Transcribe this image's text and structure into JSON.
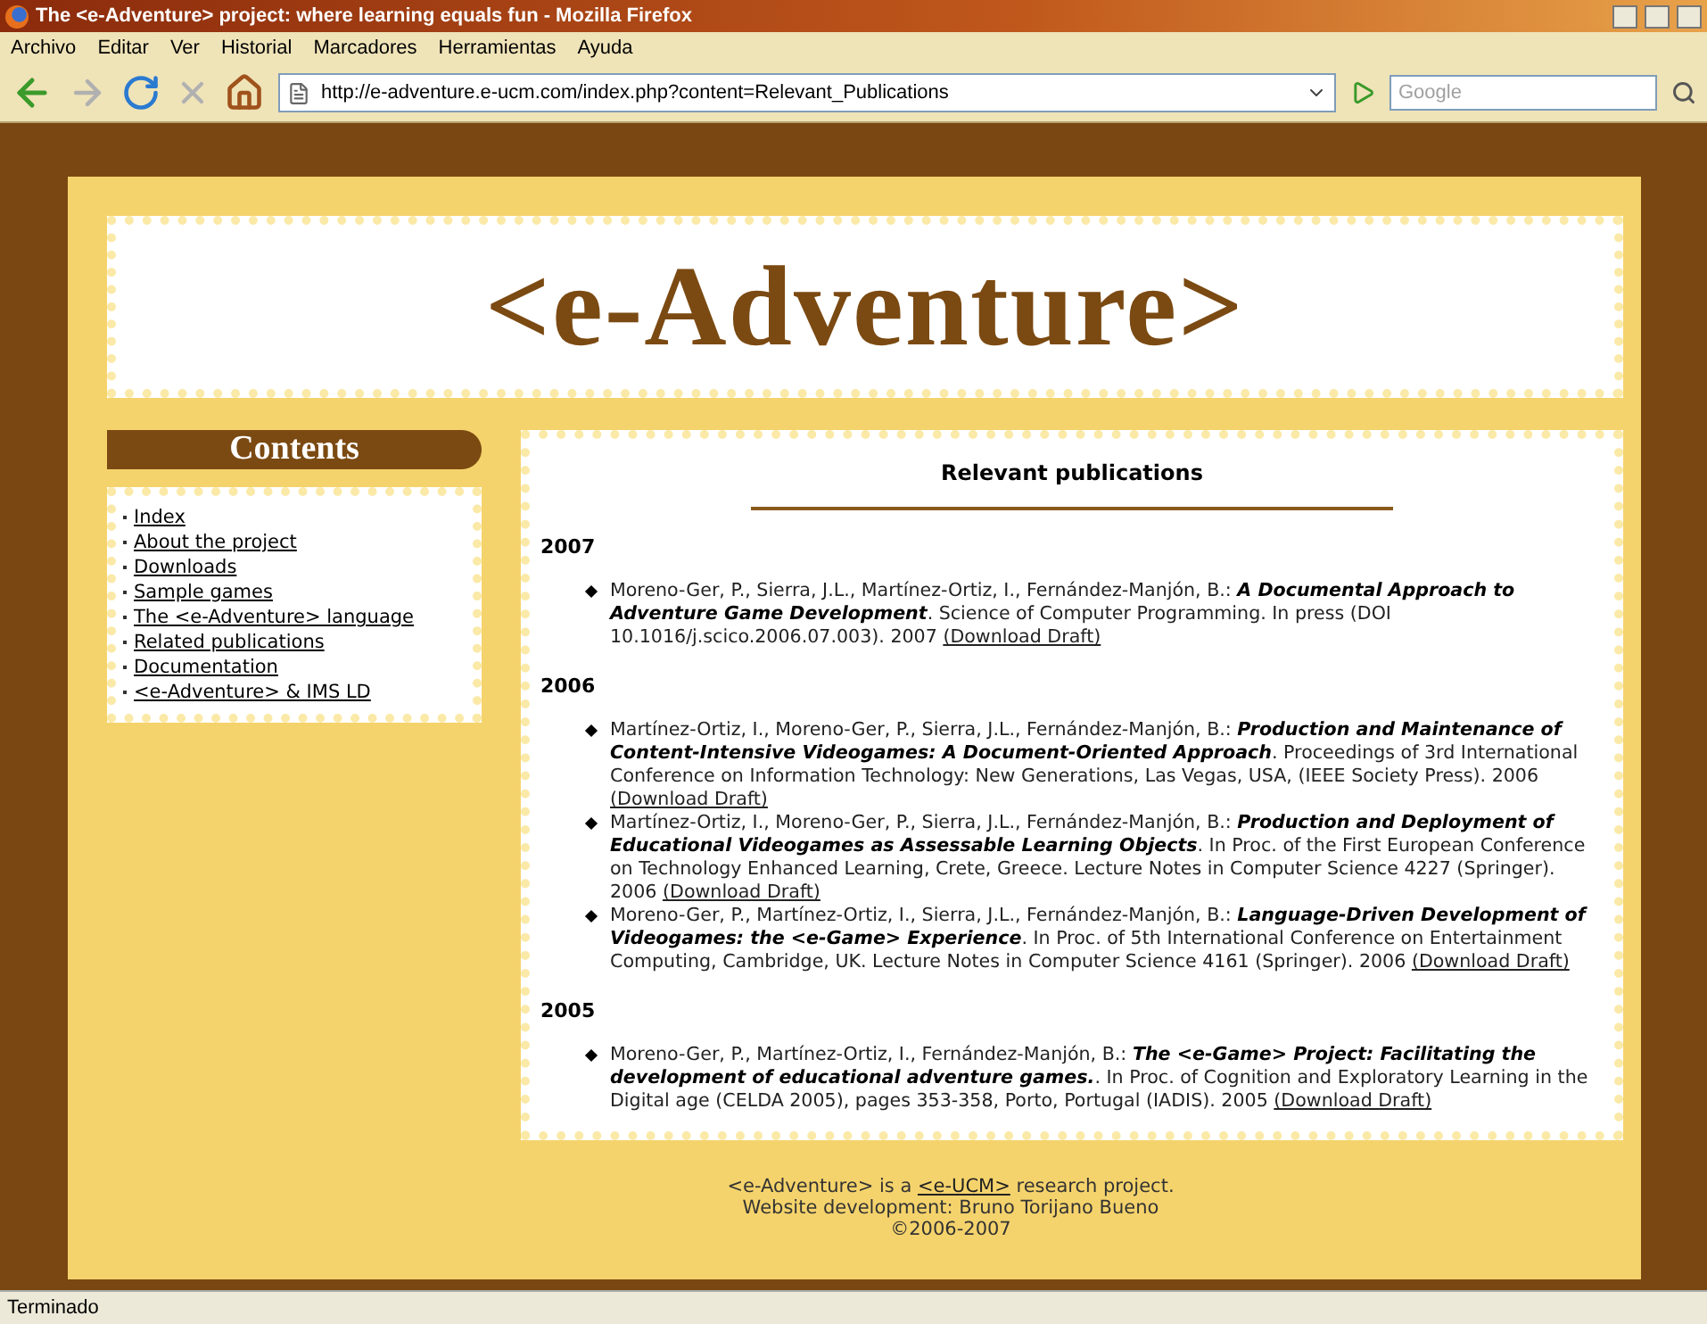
{
  "window": {
    "title": "The <e-Adventure> project: where learning equals fun - Mozilla Firefox"
  },
  "menu": [
    "Archivo",
    "Editar",
    "Ver",
    "Historial",
    "Marcadores",
    "Herramientas",
    "Ayuda"
  ],
  "address": {
    "url": "http://e-adventure.e-ucm.com/index.php?content=Relevant_Publications"
  },
  "search": {
    "placeholder": "Google"
  },
  "site": {
    "logo": "<e-Adventure>",
    "contents_title": "Contents",
    "nav": [
      "Index",
      "About the project",
      "Downloads",
      "Sample games",
      "The <e-Adventure> language",
      "Related publications",
      "Documentation",
      "<e-Adventure> & IMS LD"
    ],
    "page_title": "Relevant publications",
    "sections": [
      {
        "year": "2007",
        "publications": [
          {
            "authors": "Moreno-Ger, P., Sierra, J.L., Martínez-Ortiz, I., Fernández-Manjón, B.:",
            "title": "A Documental Approach to Adventure Game Development",
            "details": ". Science of Computer Programming. In press (DOI 10.1016/j.scico.2006.07.003). 2007",
            "link": "(Download Draft)"
          }
        ]
      },
      {
        "year": "2006",
        "publications": [
          {
            "authors": "Martínez-Ortiz, I., Moreno-Ger, P., Sierra, J.L., Fernández-Manjón, B.:",
            "title": "Production and Maintenance of Content-Intensive Videogames: A Document-Oriented Approach",
            "details": ". Proceedings of 3rd International Conference on Information Technology: New Generations, Las Vegas, USA, (IEEE Society Press). 2006",
            "link": "(Download Draft)"
          },
          {
            "authors": "Martínez-Ortiz, I., Moreno-Ger, P., Sierra, J.L., Fernández-Manjón, B.:",
            "title": "Production and Deployment of Educational Videogames as Assessable Learning Objects",
            "details": ". In Proc. of the First European Conference on Technology Enhanced Learning, Crete, Greece. Lecture Notes in Computer Science 4227 (Springer). 2006",
            "link": "(Download Draft)"
          },
          {
            "authors": "Moreno-Ger, P., Martínez-Ortiz, I., Sierra, J.L., Fernández-Manjón, B.:",
            "title": "Language-Driven Development of Videogames: the <e-Game> Experience",
            "details": ". In Proc. of 5th International Conference on Entertainment Computing, Cambridge, UK. Lecture Notes in Computer Science 4161 (Springer). 2006",
            "link": "(Download Draft)"
          }
        ]
      },
      {
        "year": "2005",
        "publications": [
          {
            "authors": "Moreno-Ger, P., Martínez-Ortiz, I., Fernández-Manjón, B.:",
            "title": "The <e-Game> Project: Facilitating the development of educational adventure games.",
            "details": ". In Proc. of Cognition and Exploratory Learning in the Digital age (CELDA 2005), pages 353-358, Porto, Portugal (IADIS). 2005",
            "link": "(Download Draft)"
          }
        ]
      }
    ],
    "footer": {
      "before": "<e-Adventure> is a",
      "link": "<e-UCM>",
      "after": "research project.",
      "lines": [
        "Website development: Bruno Torijano Bueno",
        "©2006-2007"
      ]
    }
  },
  "status_bar": "Terminado"
}
